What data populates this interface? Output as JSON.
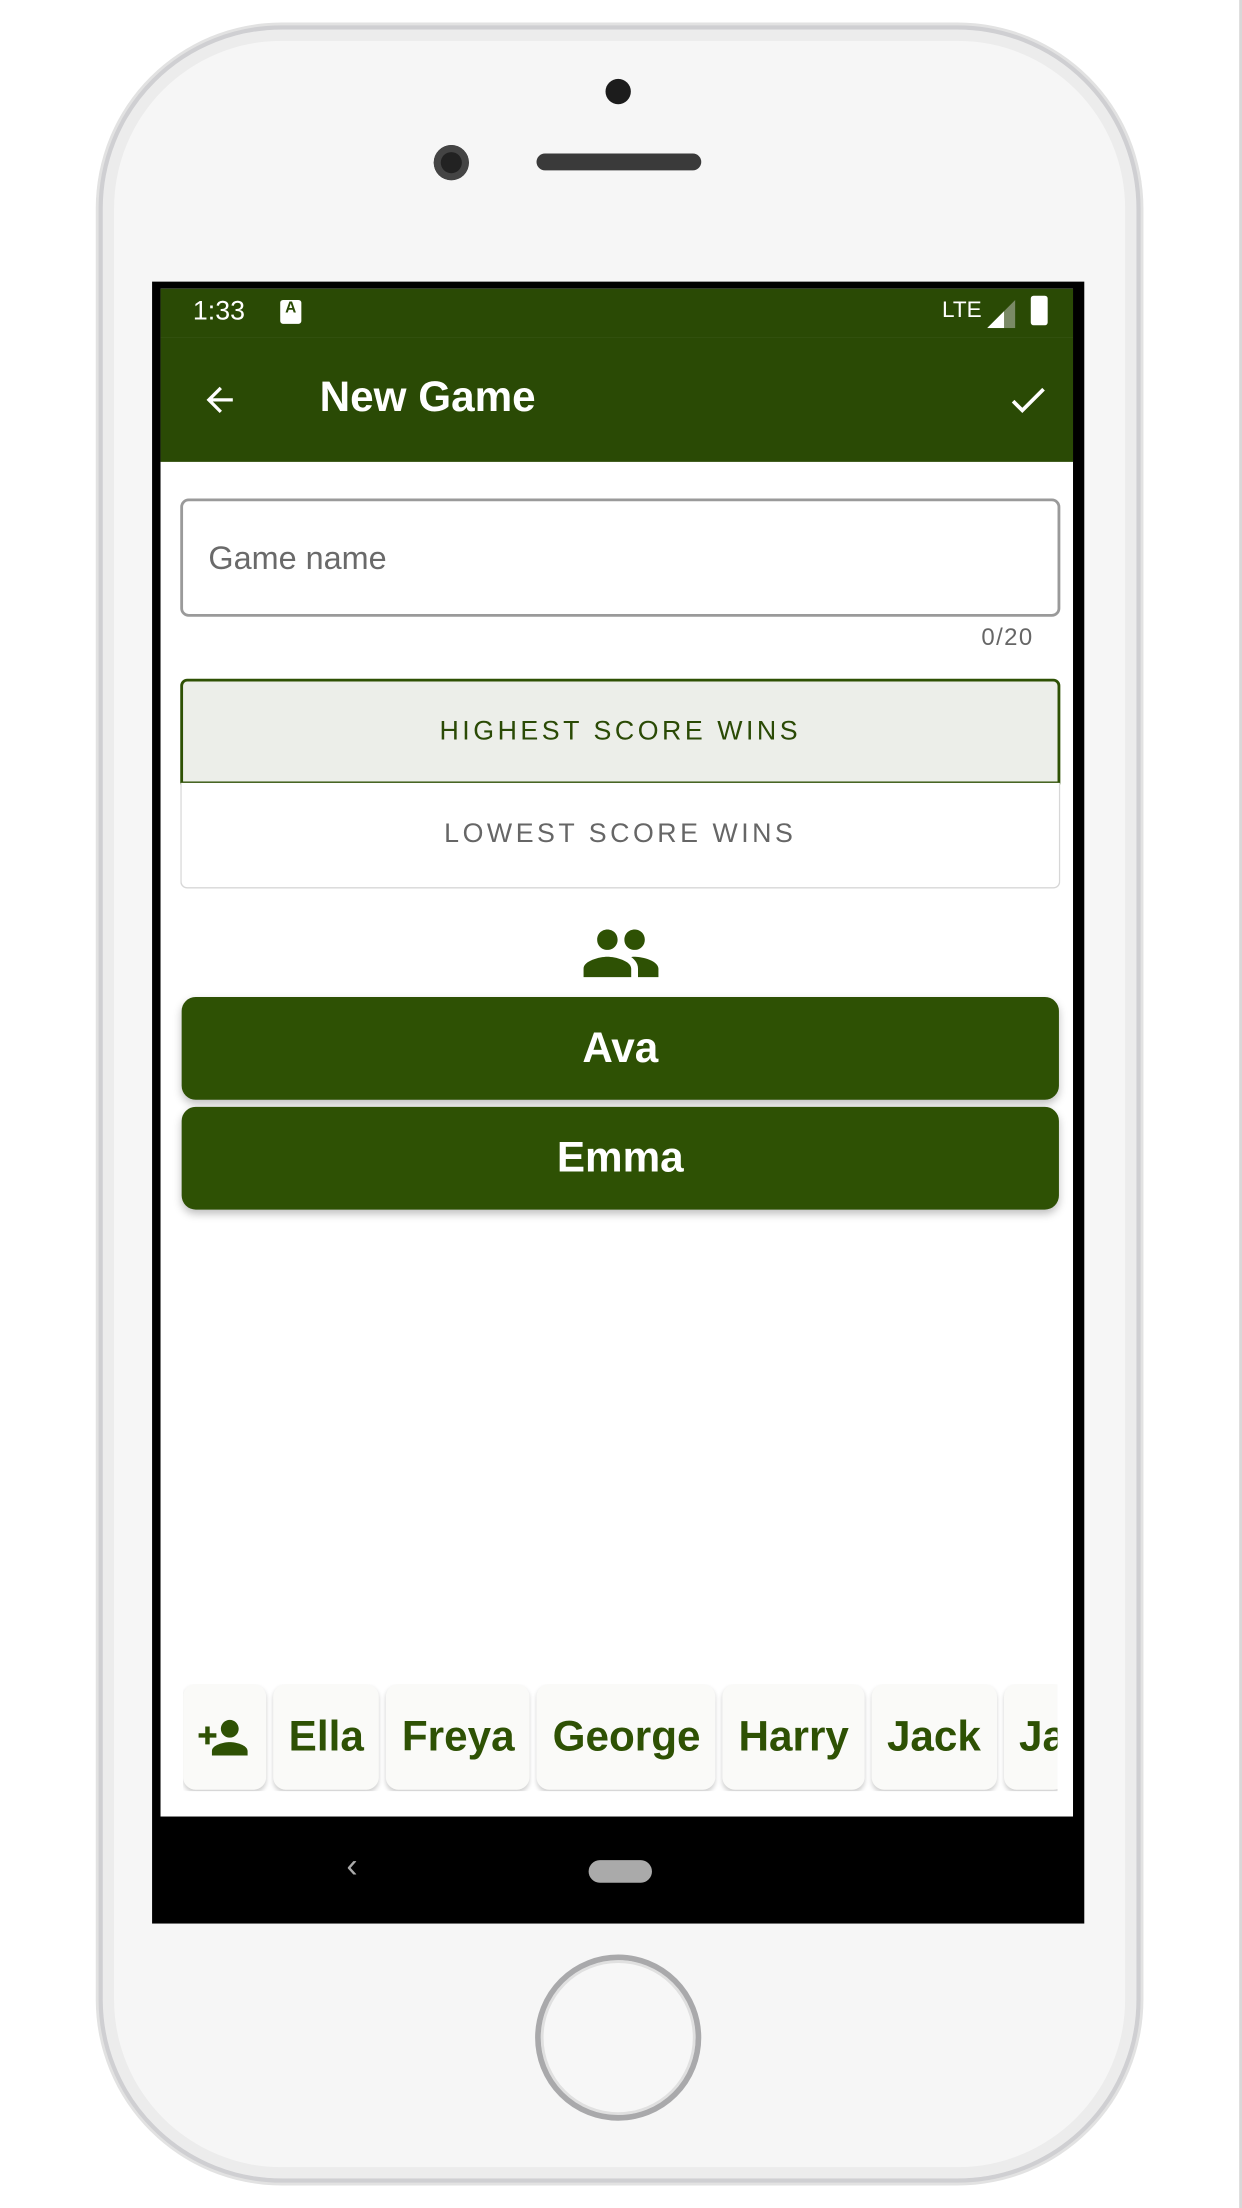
{
  "status_bar": {
    "time": "1:33",
    "network": "LTE"
  },
  "toolbar": {
    "title": "New Game",
    "back_icon": "arrow-back-icon",
    "confirm_icon": "check-icon"
  },
  "game_name": {
    "placeholder": "Game name",
    "value": "",
    "counter": "0/20"
  },
  "win_mode": {
    "options": [
      "HIGHEST SCORE WINS",
      "LOWEST SCORE WINS"
    ],
    "selected": "HIGHEST SCORE WINS"
  },
  "players_icon": "group-icon",
  "selected_players": [
    "Ava",
    "Emma"
  ],
  "available_players": [
    "Ella",
    "Freya",
    "George",
    "Harry",
    "Jack",
    "Ja"
  ],
  "colors": {
    "primary": "#2a4a05",
    "button": "#2e5104"
  }
}
